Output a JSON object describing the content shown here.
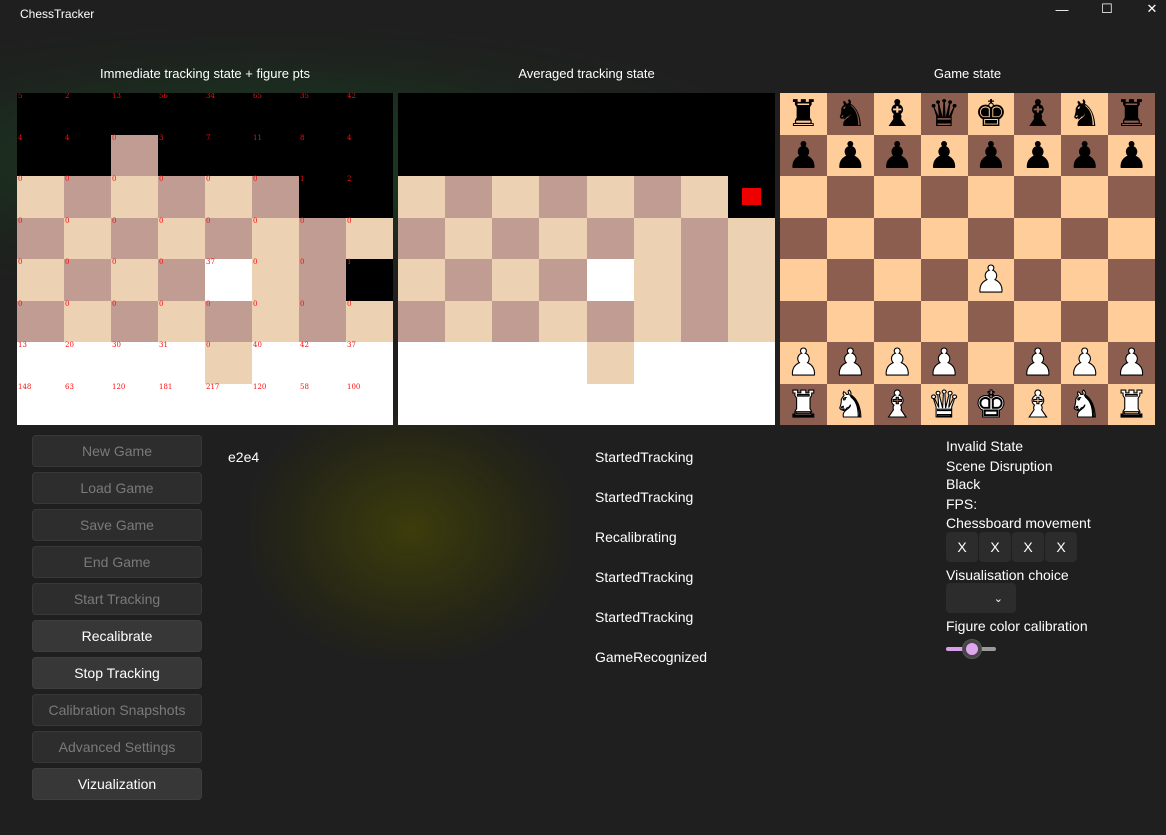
{
  "window": {
    "title": "ChessTracker",
    "minimize_glyph": "—",
    "maximize_glyph": "☐",
    "close_glyph": "✕"
  },
  "colors": {
    "board_light": "#edd1b3",
    "board_dark": "#c19c93",
    "gs_light": "#fecd9a",
    "gs_dark": "#8c5e4f",
    "marker": "#ee0000",
    "point_text": "#ff0a0a",
    "slider_accent": "#d9a0e9"
  },
  "panels": {
    "immediate": {
      "title": "Immediate tracking state + figure pts",
      "rows": [
        "XXXXXXXX",
        "XXDXXXXX",
        "LDLDLDXX",
        "DLDLDLDL",
        "LDLDWLDX",
        "DLDLDLDL",
        "WWWWLWWW",
        "WWWWWWWW"
      ],
      "points": [
        [
          "5",
          "2",
          "13",
          "56",
          "34",
          "65",
          "35",
          "42"
        ],
        [
          "4",
          "4",
          "0",
          "3",
          "7",
          "11",
          "8",
          "4"
        ],
        [
          "0",
          "0",
          "0",
          "0",
          "0",
          "0",
          "1",
          "2"
        ],
        [
          "0",
          "0",
          "0",
          "0",
          "0",
          "0",
          "0",
          "0"
        ],
        [
          "0",
          "0",
          "0",
          "0",
          "37",
          "0",
          "0",
          "1"
        ],
        [
          "0",
          "0",
          "0",
          "0",
          "0",
          "0",
          "0",
          "0"
        ],
        [
          "13",
          "20",
          "30",
          "31",
          "0",
          "40",
          "42",
          "37"
        ],
        [
          "148",
          "63",
          "120",
          "181",
          "217",
          "120",
          "58",
          "100"
        ]
      ]
    },
    "averaged": {
      "title": "Averaged tracking state",
      "rows": [
        "XXXXXXXX",
        "XXXXXXXX",
        "LDLDLDLX",
        "DLDLDLDL",
        "LDLDWLDL",
        "DLDLDLDL",
        "WWWWLWWW",
        "WWWWWWWW"
      ]
    },
    "game": {
      "title": "Game state",
      "rank8": [
        "black-rook",
        "black-knight",
        "black-bishop",
        "black-queen",
        "black-king",
        "black-bishop",
        "black-knight",
        "black-rook"
      ],
      "rank7": [
        "black-pawn",
        "black-pawn",
        "black-pawn",
        "black-pawn",
        "black-pawn",
        "black-pawn",
        "black-pawn",
        "black-pawn"
      ],
      "rank4": [
        "",
        "",
        "",
        "",
        "white-pawn",
        "",
        "",
        ""
      ],
      "rank2": [
        "white-pawn",
        "white-pawn",
        "white-pawn",
        "white-pawn",
        "",
        "white-pawn",
        "white-pawn",
        "white-pawn"
      ],
      "rank1": [
        "white-rook",
        "white-knight",
        "white-bishop",
        "white-queen",
        "white-king",
        "white-bishop",
        "white-knight",
        "white-rook"
      ]
    }
  },
  "buttons": [
    {
      "label": "New Game",
      "enabled": false
    },
    {
      "label": "Load Game",
      "enabled": false
    },
    {
      "label": "Save Game",
      "enabled": false
    },
    {
      "label": "End Game",
      "enabled": false
    },
    {
      "label": "Start Tracking",
      "enabled": false
    },
    {
      "label": "Recalibrate",
      "enabled": true
    },
    {
      "label": "Stop Tracking",
      "enabled": true
    },
    {
      "label": "Calibration Snapshots",
      "enabled": false
    },
    {
      "label": "Advanced Settings",
      "enabled": false
    },
    {
      "label": "Vizualization",
      "enabled": true
    }
  ],
  "moves": [
    "e2e4"
  ],
  "log": [
    "StartedTracking",
    "StartedTracking",
    "Recalibrating",
    "StartedTracking",
    "StartedTracking",
    "GameRecognized"
  ],
  "status": {
    "state": "Invalid State",
    "disruption": "Scene Disruption",
    "side": "Black",
    "fps": "FPS:",
    "movement_label": "Chessboard movement",
    "movement": [
      "X",
      "X",
      "X",
      "X"
    ],
    "vis_label": "Visualisation choice",
    "combo_chevron": "⌄",
    "calib_label": "Figure color calibration",
    "calib_value": 0.5
  }
}
